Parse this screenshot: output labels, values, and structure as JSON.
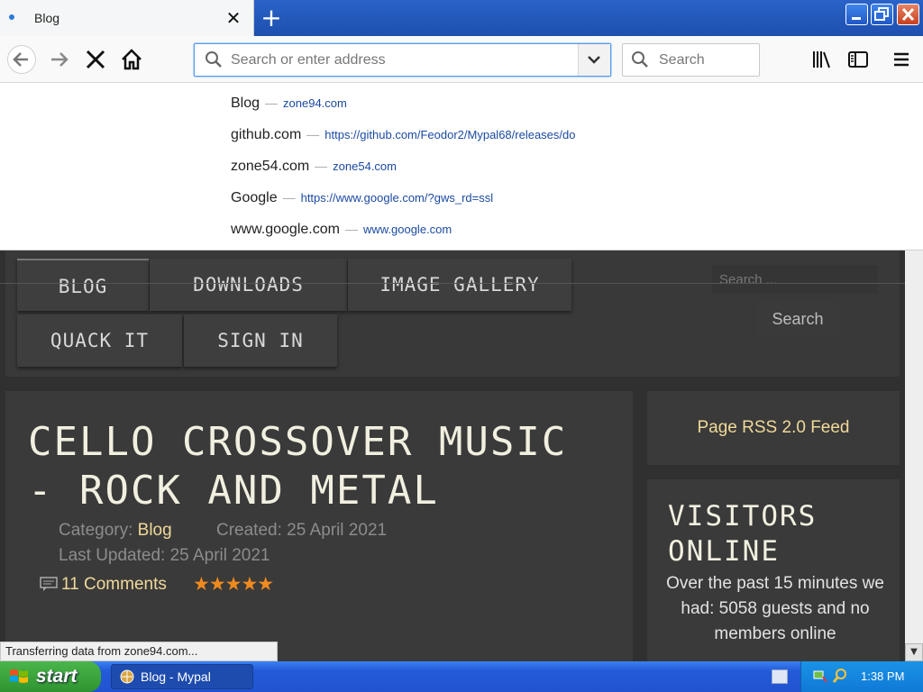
{
  "browser": {
    "tab": {
      "title": "Blog"
    },
    "urlbar": {
      "placeholder": "Search or enter address"
    },
    "searchbar": {
      "placeholder": "Search"
    },
    "suggestions": [
      {
        "title": "Blog",
        "url": "zone94.com"
      },
      {
        "title": "github.com",
        "url": "https://github.com/Feodor2/Mypal68/releases/do"
      },
      {
        "title": "zone54.com",
        "url": "zone54.com"
      },
      {
        "title": "Google",
        "url": "https://www.google.com/?gws_rd=ssl"
      },
      {
        "title": "www.google.com",
        "url": "www.google.com"
      }
    ],
    "separator": "—",
    "status": "Transferring data from zone94.com..."
  },
  "site": {
    "menu": {
      "blog": "BLOG",
      "downloads": "DOWNLOADS",
      "gallery": "IMAGE GALLERY",
      "quack": "QUACK IT",
      "signin": "SIGN IN"
    },
    "search": {
      "placeholder": "Search ...",
      "button": "Search"
    },
    "article": {
      "title": "CELLO CROSSOVER MUSIC - ROCK AND METAL",
      "category_label": "Category:",
      "category": "Blog",
      "created": "Created: 25 April 2021",
      "updated": "Last Updated: 25 April 2021",
      "comments": "11 Comments",
      "rating": 5,
      "stars": "★★★★★"
    },
    "rss": "Page RSS 2.0 Feed",
    "visitors": {
      "title": "VISITORS ONLINE",
      "text": "Over the past 15 minutes we had: 5058 guests and no members online"
    }
  },
  "taskbar": {
    "start": "start",
    "app": "Blog - Mypal",
    "clock": "1:38 PM"
  },
  "colors": {
    "accent": "#f0d999",
    "star": "#f08a1e",
    "link": "#1b4aa1"
  }
}
